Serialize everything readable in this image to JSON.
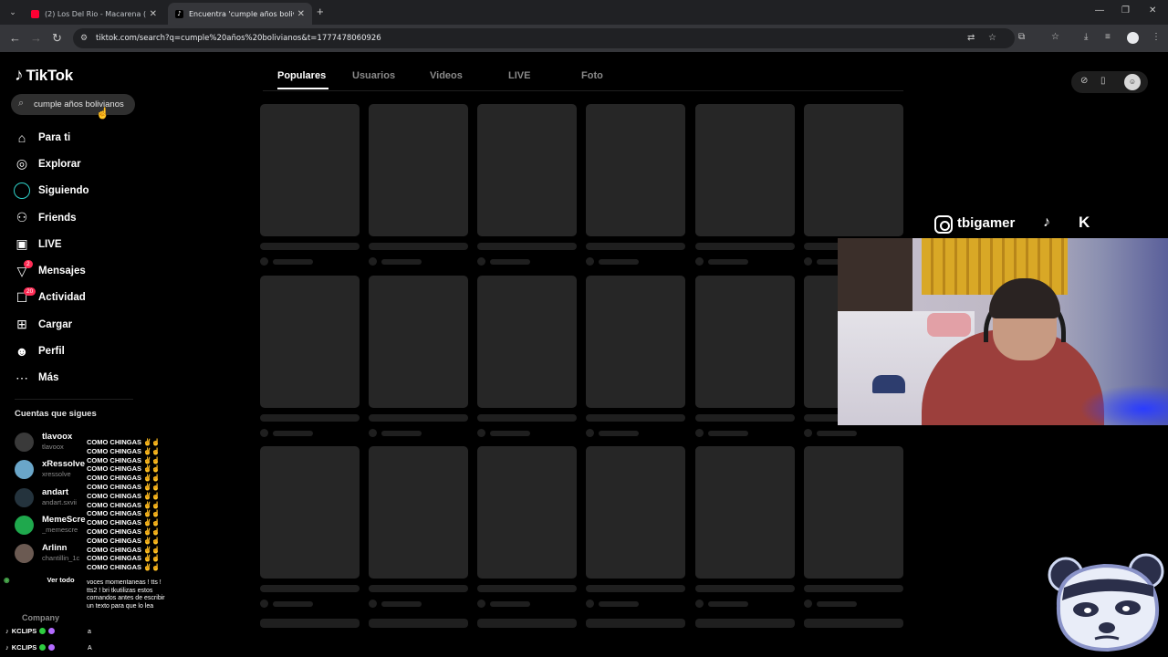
{
  "browser": {
    "tabs": [
      {
        "title": "(2) Los Del Rio - Macarena (Bay",
        "icon": "youtube-icon",
        "active": false
      },
      {
        "title": "Encuentra 'cumple años bolivia",
        "icon": "tiktok-icon",
        "active": true
      }
    ],
    "url": "tiktok.com/search?q=cumple%20años%20bolivianos&t=1777478060926"
  },
  "tiktok": {
    "logo": "TikTok",
    "search": {
      "value": "cumple años bolivianos"
    },
    "nav": [
      {
        "label": "Para ti",
        "icon": "home-icon"
      },
      {
        "label": "Explorar",
        "icon": "compass-icon"
      },
      {
        "label": "Siguiendo",
        "icon": "following-ring-icon"
      },
      {
        "label": "Friends",
        "icon": "friends-icon"
      },
      {
        "label": "LIVE",
        "icon": "live-icon"
      },
      {
        "label": "Mensajes",
        "icon": "messages-icon",
        "badge": "2"
      },
      {
        "label": "Actividad",
        "icon": "activity-icon",
        "badge": "20"
      },
      {
        "label": "Cargar",
        "icon": "upload-icon"
      },
      {
        "label": "Perfil",
        "icon": "profile-icon"
      },
      {
        "label": "Más",
        "icon": "more-icon"
      }
    ],
    "following_title": "Cuentas que sigues",
    "following": [
      {
        "name": "tlavoox",
        "handle": "tlavoox"
      },
      {
        "name": "xRessolve",
        "handle": "xressolve"
      },
      {
        "name": "andart",
        "handle": "andart.sxvii"
      },
      {
        "name": "MemeScre",
        "handle": "_memescre"
      },
      {
        "name": "Arlinn",
        "handle": "chantillin_1c"
      }
    ],
    "ver_todo": "Ver todo",
    "company": "Company",
    "tabs": [
      "Populares",
      "Usuarios",
      "Videos",
      "LIVE",
      "Foto"
    ],
    "active_tab": "Populares"
  },
  "stream_overlay": {
    "chat_repeat": "COMO CHINGAS",
    "chat_repeat_count": 15,
    "chat_message": "voces momentaneas ! tts ! tts2 ! bri tkutilizas estos comandos antes de escribir un texto para que lo lea",
    "kclips": [
      {
        "user": "KCLIPS",
        "msg": "a"
      },
      {
        "user": "KCLIPS",
        "msg": "A"
      }
    ],
    "social_handle": "tbigamer"
  }
}
